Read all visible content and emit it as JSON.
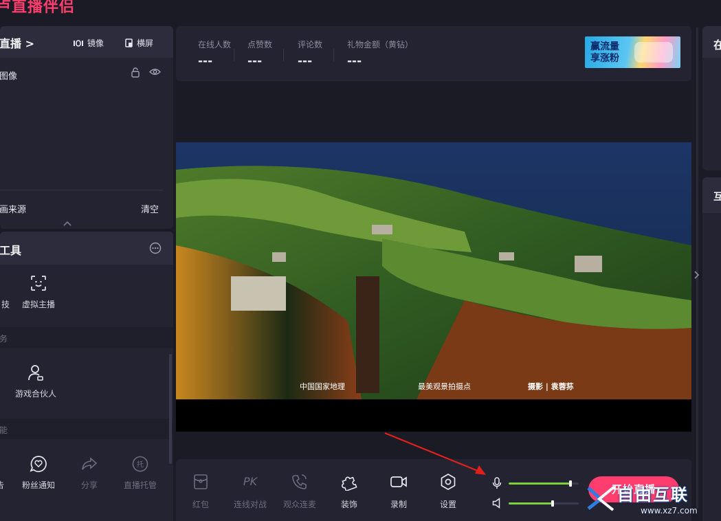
{
  "app": {
    "title": "卢直播伴侣"
  },
  "scene": {
    "header_title": "直播 >",
    "mirror_label": "镜像",
    "landscape_label": "横屏",
    "layer_name": "图像",
    "source_label": "画来源",
    "clear_label": "清空"
  },
  "tools": {
    "title": "工具",
    "row1": [
      {
        "label": "技"
      },
      {
        "label": "虚拟主播"
      }
    ],
    "section1": "务",
    "row2": [
      {
        "label": "游戏合伙人"
      }
    ],
    "section2": "能",
    "row3": [
      {
        "label": "告"
      },
      {
        "label": "粉丝通知"
      },
      {
        "label": "分享"
      },
      {
        "label": "直播托管"
      }
    ]
  },
  "stats": {
    "items": [
      {
        "label": "在线人数",
        "value": "---"
      },
      {
        "label": "点赞数",
        "value": "---"
      },
      {
        "label": "评论数",
        "value": "---"
      },
      {
        "label": "礼物金额（黄钻）",
        "value": "---"
      }
    ],
    "ad_text_line1": "赢流量",
    "ad_text_line2": "享涨粉"
  },
  "preview": {
    "caption_left": "中国国家地理",
    "caption_mid": "最美观景拍摄点",
    "caption_right": "摄影 | 袁蓉荪"
  },
  "controls": {
    "items": [
      {
        "label": "红包"
      },
      {
        "label": "连线对战",
        "icon_text": "PK"
      },
      {
        "label": "观众连麦"
      },
      {
        "label": "装饰"
      },
      {
        "label": "录制"
      },
      {
        "label": "设置"
      }
    ],
    "mic_level": 0.88,
    "speaker_level": 0.63,
    "start_label": "开始直播"
  },
  "right_panel": {
    "top_title": "在",
    "bottom_title": "互"
  },
  "watermark": {
    "title": "自由互联",
    "url": "www.xz7.com"
  },
  "colors": {
    "accent": "#ff3d6e",
    "level_fill": "#7ed13c",
    "panel": "#232331",
    "background": "#1b1b26"
  }
}
